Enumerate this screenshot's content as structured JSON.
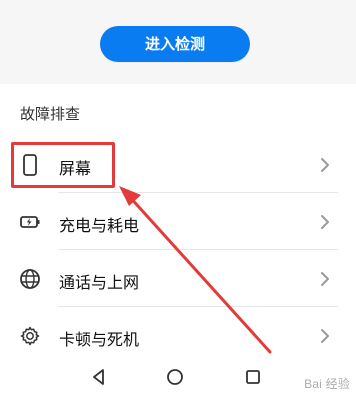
{
  "header": {
    "cta_label": "进入检测"
  },
  "section": {
    "title": "故障排查"
  },
  "items": [
    {
      "label": "屏幕",
      "icon": "phone-screen-icon"
    },
    {
      "label": "充电与耗电",
      "icon": "battery-charge-icon"
    },
    {
      "label": "通话与上网",
      "icon": "globe-icon"
    },
    {
      "label": "卡顿与死机",
      "icon": "settings-gear-icon"
    }
  ],
  "nav": {
    "icons": [
      "back-triangle-icon",
      "home-circle-icon",
      "recent-square-icon"
    ]
  },
  "annotation": {
    "highlight_color": "#e33a3a",
    "arrow_color": "#e33a3a"
  },
  "watermark": {
    "text": "Bai 经验"
  },
  "colors": {
    "accent": "#0a7cf2",
    "background": "#ffffff",
    "top_area": "#f6f6f6"
  }
}
